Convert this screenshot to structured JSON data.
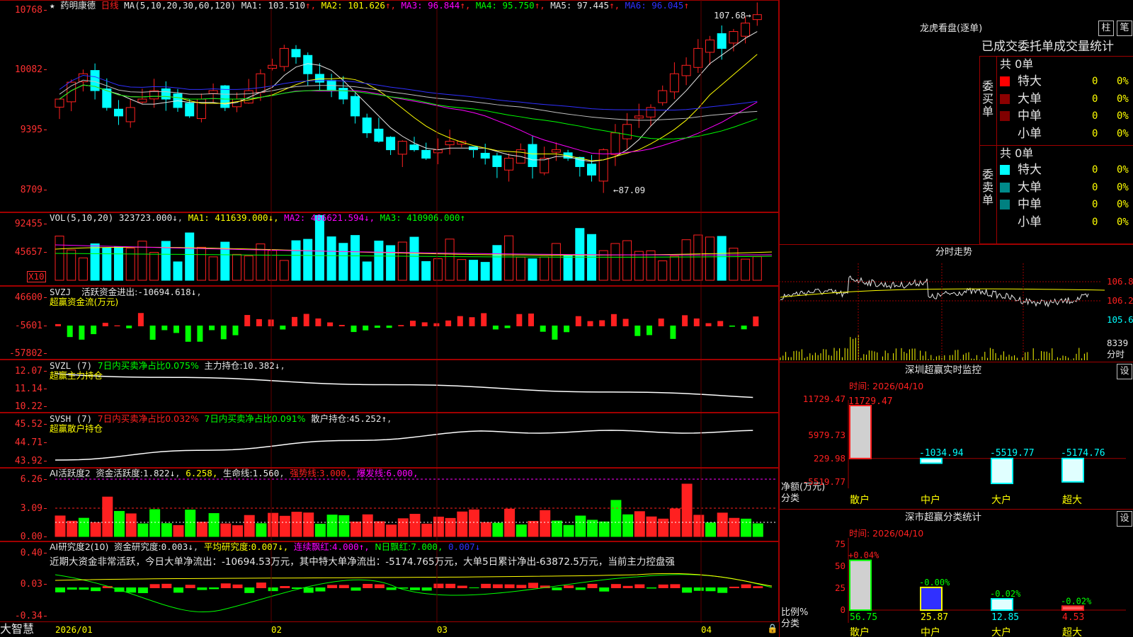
{
  "main": {
    "title_star": "★",
    "stock": "药明康德",
    "period": "日线",
    "ma_params": "MA(5,10,20,30,60,120)",
    "ma": [
      {
        "label": "MA1:",
        "value": "103.510",
        "arrow": "↑",
        "color": "#e6e6e6"
      },
      {
        "label": "MA2:",
        "value": "101.626",
        "arrow": "↑",
        "color": "#ffff00"
      },
      {
        "label": "MA3:",
        "value": "96.844",
        "arrow": "↑",
        "color": "#ff00ff"
      },
      {
        "label": "MA4:",
        "value": "95.750",
        "arrow": "↑",
        "color": "#00ff00"
      },
      {
        "label": "MA5:",
        "value": "97.445",
        "arrow": "↑",
        "color": "#e6e6e6"
      },
      {
        "label": "MA6:",
        "value": "96.045",
        "arrow": "↑",
        "color": "#3030ff"
      }
    ],
    "axis": [
      "10768",
      "10082",
      "9395",
      "8709"
    ],
    "high_label": "107.68",
    "low_label": "87.09"
  },
  "vol": {
    "header": "VOL(5,10,20)",
    "value": "323723.000",
    "items": [
      {
        "label": "MA1:",
        "value": "411639.000",
        "arrow": "↓",
        "color": "#ffff00"
      },
      {
        "label": "MA2:",
        "value": "466621.594",
        "arrow": "↓",
        "color": "#ff00ff"
      },
      {
        "label": "MA3:",
        "value": "410906.000",
        "arrow": "↑",
        "color": "#00ff00"
      }
    ],
    "axis": [
      "92455",
      "45657"
    ],
    "unit": "X10"
  },
  "svzj": {
    "header": "SVZJ",
    "line1": "活跃资金进出:",
    "value": "-10694.618",
    "arrow": "↓",
    "sub": "超赢资金流(万元)",
    "axis": [
      "46600",
      "-5601",
      "-57802"
    ]
  },
  "svzl": {
    "header": "SVZL (7)",
    "item1": "7日内买卖净占比0.075%",
    "item2": "主力持仓:",
    "value": "10.382",
    "arrow": "↓",
    "sub": "超赢主力持仓",
    "axis": [
      "12.07",
      "11.14",
      "10.22"
    ]
  },
  "svsh": {
    "header": "SVSH (7)",
    "item1": "7日内买卖净占比0.032%",
    "item2": "7日内买卖净占比0.091%",
    "item3": "散户持仓:",
    "value": "45.252",
    "arrow": "↑",
    "sub": "超赢散户持仓",
    "axis": [
      "45.52",
      "44.71",
      "43.92"
    ]
  },
  "ai1": {
    "header": "AI活跃度2",
    "l1": "资金活跃度:",
    "v1": "1.822",
    "a1": "↓",
    "v2": "6.258",
    "l3": "生命线:",
    "v3": "1.560",
    "l4": "强势线:",
    "v4": "3.000",
    "l5": "爆发线:",
    "v5": "6.000",
    "axis": [
      "6.26",
      "3.09",
      "0.00"
    ]
  },
  "ai2": {
    "header": "AI研究度2(10)",
    "l1": "资金研究度:",
    "v1": "0.003",
    "a1": "↓",
    "l2": "平均研究度:",
    "v2": "0.007",
    "a2": "↓",
    "l3": "连续飘红:",
    "v3": "4.000",
    "a3": "↑",
    "l4": "N日飘红:",
    "v4": "7.000",
    "v5": "0.007",
    "a5": "↓",
    "comment": "近期大资金非常活跃，今日大单净流出：-10694.53万元，其中特大单净流出：-5174.765万元，大单5日累计净出-63872.5万元，当前主力控盘强",
    "axis": [
      "0.40",
      "0.03",
      "-0.34"
    ]
  },
  "bottom": {
    "brand": "大智慧",
    "dates": [
      "2026/01",
      "02",
      "03",
      "04"
    ]
  },
  "longhu": {
    "title": "龙虎看盘(逐单)",
    "btn_bar": "柱",
    "btn_pen": "笔",
    "header": "已成交委托单成交量统计",
    "buy_label": "委买单",
    "sell_label": "委卖单",
    "buy_total": "共 0单",
    "sell_total": "共 0单",
    "buy_rows": [
      {
        "name": "特大",
        "count": "0",
        "pct": "0%",
        "color": "#ff0000"
      },
      {
        "name": "大单",
        "count": "0",
        "pct": "0%",
        "color": "#8b0000"
      },
      {
        "name": "中单",
        "count": "0",
        "pct": "0%",
        "color": "#800000"
      },
      {
        "name": "小单",
        "count": "0",
        "pct": "0%",
        "color": "#000000"
      }
    ],
    "sell_rows": [
      {
        "name": "特大",
        "count": "0",
        "pct": "0%",
        "color": "#00ffff"
      },
      {
        "name": "大单",
        "count": "0",
        "pct": "0%",
        "color": "#008b8b"
      },
      {
        "name": "中单",
        "count": "0",
        "pct": "0%",
        "color": "#008080"
      },
      {
        "name": "小单",
        "count": "0",
        "pct": "0%",
        "color": "#000000"
      }
    ]
  },
  "intraday": {
    "title": "分时走势",
    "prices": [
      "106.8",
      "106.2",
      "105.6"
    ],
    "vol": "8339",
    "vol_unit": "分时"
  },
  "sz": {
    "title": "深圳超赢实时监控",
    "btn": "设",
    "time": "时间: 2026/04/10",
    "axis": [
      "11729.47",
      "5979.73",
      "229.98",
      "-5519.77"
    ],
    "ylabel1": "净额(万元)",
    "ylabel2": "分类",
    "categories": [
      "散户",
      "中户",
      "大户",
      "超大"
    ],
    "values": [
      "11729.47",
      "-1034.94",
      "-5519.77",
      "-5174.76"
    ]
  },
  "ss": {
    "title": "深市超赢分类统计",
    "btn": "设",
    "time": "时间: 2026/04/10",
    "axis": [
      "75",
      "50",
      "25",
      "0"
    ],
    "ylabel1": "比例%",
    "ylabel2": "分类",
    "categories": [
      "散户",
      "中户",
      "大户",
      "超大"
    ],
    "values": [
      "56.75",
      "25.87",
      "12.85",
      "4.53"
    ],
    "changes": [
      "+0.04%",
      "-0.00%",
      "-0.02%",
      "-0.02%"
    ]
  },
  "chart_data": [
    {
      "type": "bar",
      "title": "深圳超赢实时监控",
      "categories": [
        "散户",
        "中户",
        "大户",
        "超大"
      ],
      "values": [
        11729.47,
        -1034.94,
        -5519.77,
        -5174.76
      ],
      "ylim": [
        -5519.77,
        11729.47
      ],
      "ylabel": "净额(万元)"
    },
    {
      "type": "bar",
      "title": "深市超赢分类统计",
      "categories": [
        "散户",
        "中户",
        "大户",
        "超大"
      ],
      "values": [
        56.75,
        25.87,
        12.85,
        4.53
      ],
      "ylim": [
        0,
        75
      ],
      "ylabel": "比例%"
    }
  ]
}
